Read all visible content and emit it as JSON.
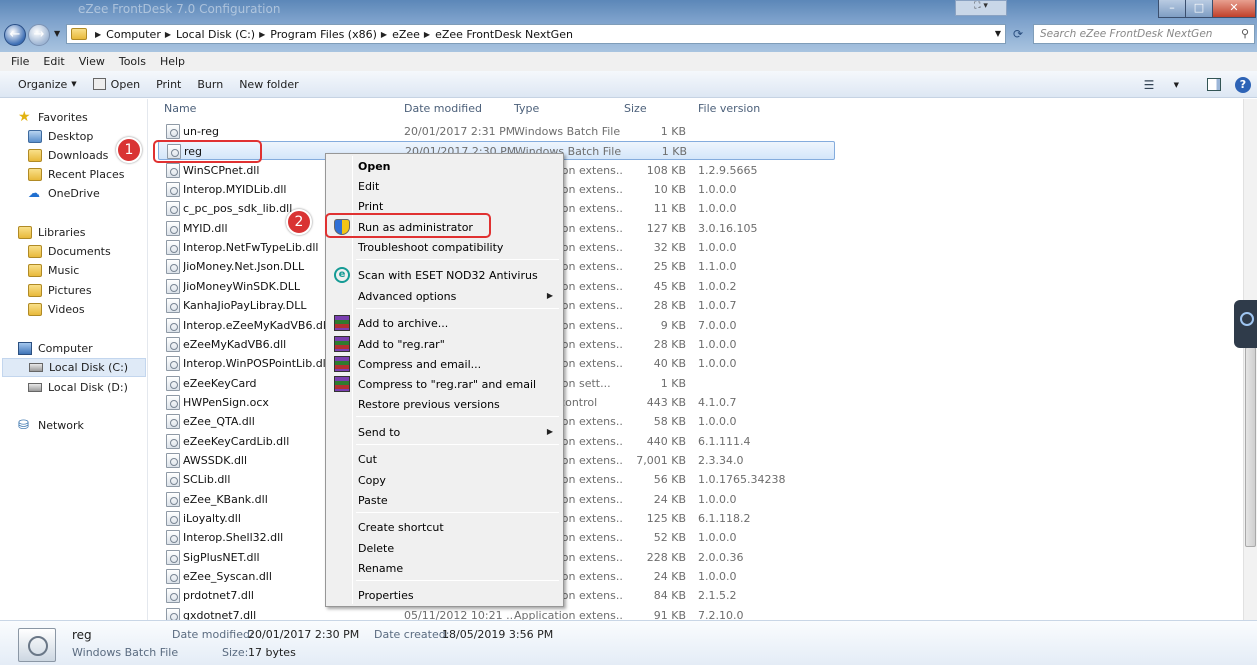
{
  "window": {
    "title": "eZee FrontDesk 7.0 Configuration"
  },
  "address": {
    "crumbs": [
      "Computer",
      "Local Disk (C:)",
      "Program Files (x86)",
      "eZee",
      "eZee FrontDesk NextGen"
    ]
  },
  "search": {
    "placeholder": "Search eZee FrontDesk NextGen"
  },
  "menubar": [
    "File",
    "Edit",
    "View",
    "Tools",
    "Help"
  ],
  "toolbar": {
    "organize": "Organize",
    "open": "Open",
    "print": "Print",
    "burn": "Burn",
    "new_folder": "New folder"
  },
  "nav": {
    "favorites": "Favorites",
    "desktop": "Desktop",
    "downloads": "Downloads",
    "recent": "Recent Places",
    "onedrive": "OneDrive",
    "libraries": "Libraries",
    "documents": "Documents",
    "music": "Music",
    "pictures": "Pictures",
    "videos": "Videos",
    "computer": "Computer",
    "disk_c": "Local Disk (C:)",
    "disk_d": "Local Disk (D:)",
    "network": "Network"
  },
  "columns": {
    "name": "Name",
    "date": "Date modified",
    "type": "Type",
    "size": "Size",
    "version": "File version"
  },
  "files": [
    {
      "name": "un-reg",
      "date": "20/01/2017 2:31 PM",
      "type": "Windows Batch File",
      "size": "1 KB",
      "version": ""
    },
    {
      "name": "reg",
      "date": "20/01/2017 2:30 PM",
      "type": "Windows Batch File",
      "size": "1 KB",
      "version": ""
    },
    {
      "name": "WinSCPnet.dll",
      "date": "",
      "type": "Application extens...",
      "size": "108 KB",
      "version": "1.2.9.5665"
    },
    {
      "name": "Interop.MYIDLib.dll",
      "date": "",
      "type": "Application extens...",
      "size": "10 KB",
      "version": "1.0.0.0"
    },
    {
      "name": "c_pc_pos_sdk_lib.dll",
      "date": "",
      "type": "Application extens...",
      "size": "11 KB",
      "version": "1.0.0.0"
    },
    {
      "name": "MYID.dll",
      "date": "",
      "type": "Application extens...",
      "size": "127 KB",
      "version": "3.0.16.105"
    },
    {
      "name": "Interop.NetFwTypeLib.dll",
      "date": "",
      "type": "Application extens...",
      "size": "32 KB",
      "version": "1.0.0.0"
    },
    {
      "name": "JioMoney.Net.Json.DLL",
      "date": "",
      "type": "Application extens...",
      "size": "25 KB",
      "version": "1.1.0.0"
    },
    {
      "name": "JioMoneyWinSDK.DLL",
      "date": "",
      "type": "Application extens...",
      "size": "45 KB",
      "version": "1.0.0.2"
    },
    {
      "name": "KanhaJioPayLibray.DLL",
      "date": "",
      "type": "Application extens...",
      "size": "28 KB",
      "version": "1.0.0.7"
    },
    {
      "name": "Interop.eZeeMyKadVB6.dll",
      "date": "",
      "type": "Application extens...",
      "size": "9 KB",
      "version": "7.0.0.0"
    },
    {
      "name": "eZeeMyKadVB6.dll",
      "date": "",
      "type": "Application extens...",
      "size": "28 KB",
      "version": "1.0.0.0"
    },
    {
      "name": "Interop.WinPOSPointLib.dll",
      "date": "",
      "type": "Application extens...",
      "size": "40 KB",
      "version": "1.0.0.0"
    },
    {
      "name": "eZeeKeyCard",
      "date": "",
      "type": "Application sett...",
      "size": "1 KB",
      "version": ""
    },
    {
      "name": "HWPenSign.ocx",
      "date": "",
      "type": "ActiveX control",
      "size": "443 KB",
      "version": "4.1.0.7"
    },
    {
      "name": "eZee_QTA.dll",
      "date": "",
      "type": "Application extens...",
      "size": "58 KB",
      "version": "1.0.0.0"
    },
    {
      "name": "eZeeKeyCardLib.dll",
      "date": "",
      "type": "Application extens...",
      "size": "440 KB",
      "version": "6.1.111.4"
    },
    {
      "name": "AWSSDK.dll",
      "date": "",
      "type": "Application extens...",
      "size": "7,001 KB",
      "version": "2.3.34.0"
    },
    {
      "name": "SCLib.dll",
      "date": "",
      "type": "Application extens...",
      "size": "56 KB",
      "version": "1.0.1765.34238"
    },
    {
      "name": "eZee_KBank.dll",
      "date": "",
      "type": "Application extens...",
      "size": "24 KB",
      "version": "1.0.0.0"
    },
    {
      "name": "iLoyalty.dll",
      "date": "",
      "type": "Application extens...",
      "size": "125 KB",
      "version": "6.1.118.2"
    },
    {
      "name": "Interop.Shell32.dll",
      "date": "",
      "type": "Application extens...",
      "size": "52 KB",
      "version": "1.0.0.0"
    },
    {
      "name": "SigPlusNET.dll",
      "date": "",
      "type": "Application extens...",
      "size": "228 KB",
      "version": "2.0.0.36"
    },
    {
      "name": "eZee_Syscan.dll",
      "date": "",
      "type": "Application extens...",
      "size": "24 KB",
      "version": "1.0.0.0"
    },
    {
      "name": "prdotnet7.dll",
      "date": "",
      "type": "Application extens...",
      "size": "84 KB",
      "version": "2.1.5.2"
    },
    {
      "name": "gxdotnet7.dll",
      "date": "05/11/2012 10:21 ...",
      "type": "Application extens...",
      "size": "91 KB",
      "version": "7.2.10.0"
    }
  ],
  "context_menu": {
    "open": "Open",
    "edit": "Edit",
    "print": "Print",
    "run_admin": "Run as administrator",
    "troubleshoot": "Troubleshoot compatibility",
    "eset": "Scan with ESET NOD32 Antivirus",
    "advanced": "Advanced options",
    "add_archive": "Add to archive...",
    "add_rar": "Add to \"reg.rar\"",
    "compress_email": "Compress and email...",
    "compress_rar_email": "Compress to \"reg.rar\" and email",
    "restore": "Restore previous versions",
    "send_to": "Send to",
    "cut": "Cut",
    "copy": "Copy",
    "paste": "Paste",
    "create_shortcut": "Create shortcut",
    "delete": "Delete",
    "rename": "Rename",
    "properties": "Properties"
  },
  "callouts": {
    "one": "1",
    "two": "2",
    "highlight_color": "#e03131"
  },
  "details": {
    "name": "reg",
    "type": "Windows Batch File",
    "modified_label": "Date modified:",
    "modified": "20/01/2017 2:30 PM",
    "size_label": "Size:",
    "size": "17 bytes",
    "created_label": "Date created:",
    "created": "18/05/2019 3:56 PM"
  }
}
